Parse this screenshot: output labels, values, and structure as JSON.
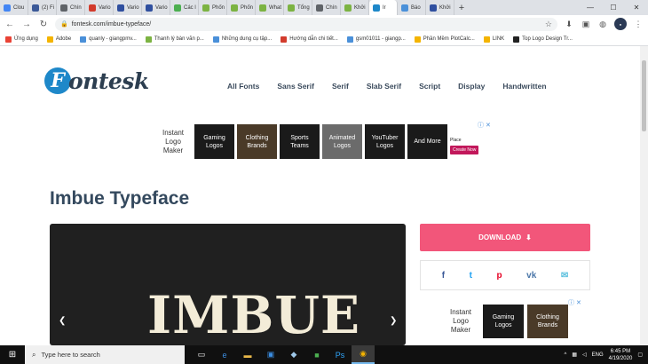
{
  "browser": {
    "tabs": [
      {
        "label": "Clou",
        "color": "#4285f4"
      },
      {
        "label": "(2) Fi",
        "color": "#3b5998"
      },
      {
        "label": "Chín",
        "color": "#5f6368"
      },
      {
        "label": "Vario",
        "color": "#d23b2c"
      },
      {
        "label": "Vario",
        "color": "#2f4f9f"
      },
      {
        "label": "Vario",
        "color": "#2f4f9f"
      },
      {
        "label": "Các l",
        "color": "#4caf50"
      },
      {
        "label": "Phốn",
        "color": "#7cb342"
      },
      {
        "label": "Phốn",
        "color": "#7cb342"
      },
      {
        "label": "What",
        "color": "#7cb342"
      },
      {
        "label": "Tổng",
        "color": "#7cb342"
      },
      {
        "label": "Chín",
        "color": "#5f6368"
      },
      {
        "label": "Khởi",
        "color": "#7cb342"
      },
      {
        "label": "Ir",
        "color": "#1e88c9"
      },
      {
        "label": "Báo",
        "color": "#4a90d9"
      },
      {
        "label": "Khởi",
        "color": "#2f4f9f"
      }
    ],
    "active_tab_index": 13,
    "url": "fontesk.com/imbue-typeface/",
    "bookmarks": [
      {
        "label": "Ứng dụng",
        "color": "#e94235"
      },
      {
        "label": "Adobe",
        "color": "#f4b400"
      },
      {
        "label": "quanly - giangpmv...",
        "color": "#4a90d9"
      },
      {
        "label": "Thanh lý bàn văn p...",
        "color": "#7cb342"
      },
      {
        "label": "Những dung cụ tập...",
        "color": "#4a90d9"
      },
      {
        "label": "Hướng dẫn chi tiết...",
        "color": "#d23b2c"
      },
      {
        "label": "gsm01011 - giangp...",
        "color": "#4a90d9"
      },
      {
        "label": "Phần Mềm PlotCalc...",
        "color": "#f4b400"
      },
      {
        "label": "LINK",
        "color": "#f4b400"
      },
      {
        "label": "Top Logo Design Tr...",
        "color": "#222222"
      }
    ]
  },
  "site": {
    "logo_mark": "F",
    "logo_text": "ontesk",
    "nav": [
      "All Fonts",
      "Sans Serif",
      "Serif",
      "Slab Serif",
      "Script",
      "Display",
      "Handwritten"
    ]
  },
  "ad_top": {
    "intro": "Instant Logo Maker",
    "tiles": [
      "Gaming Logos",
      "Clothing Brands",
      "Sports Teams",
      "Animated Logos",
      "YouTuber Logos",
      "And More"
    ],
    "place_label": "Place",
    "cta": "Create Now"
  },
  "page": {
    "title": "Imbue Typeface",
    "hero_text": "IMBUE",
    "download_label": "DOWNLOAD"
  },
  "share_icons": [
    {
      "name": "facebook",
      "glyph": "f",
      "color": "#3b5998"
    },
    {
      "name": "twitter",
      "glyph": "t",
      "color": "#1da1f2"
    },
    {
      "name": "pinterest",
      "glyph": "p",
      "color": "#e60023"
    },
    {
      "name": "vk",
      "glyph": "vk",
      "color": "#4a76a8"
    },
    {
      "name": "email",
      "glyph": "✉",
      "color": "#5bc0de"
    }
  ],
  "ad_side": {
    "intro": "Instant Logo Maker",
    "tiles": [
      "Gaming Logos",
      "Clothing Brands"
    ]
  },
  "taskbar": {
    "search_placeholder": "Type here to search",
    "time": "6:45 PM",
    "date": "4/19/2020",
    "lang": "ENG"
  }
}
